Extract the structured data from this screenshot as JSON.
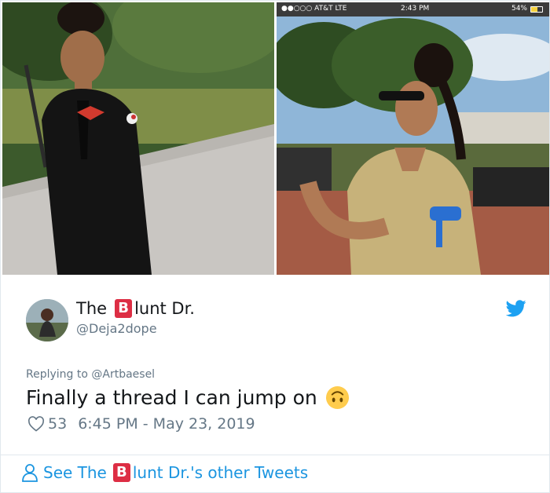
{
  "status_bar": {
    "carrier": "●●○○○ AT&T  LTE",
    "time": "2:43 PM",
    "battery": "54%",
    "battery_level": 0.54
  },
  "author": {
    "name_prefix": "The",
    "name_badge": "B",
    "name_suffix": "lunt Dr.",
    "handle": "@Deja2dope"
  },
  "tweet": {
    "replying_to": "Replying to @Artbaesel",
    "text": "Finally a thread I can jump on",
    "likes": "53",
    "timestamp": "6:45 PM - May 23, 2019"
  },
  "footer": {
    "prefix": "See The",
    "badge": "B",
    "suffix": "lunt Dr.'s other Tweets"
  },
  "colors": {
    "link": "#1b95e0",
    "muted": "#657786",
    "badge_red": "#dd2e44",
    "twitter_blue": "#1da1f2"
  },
  "icons": [
    "twitter-bird-icon",
    "heart-icon",
    "person-icon",
    "upside-down-face-emoji"
  ]
}
